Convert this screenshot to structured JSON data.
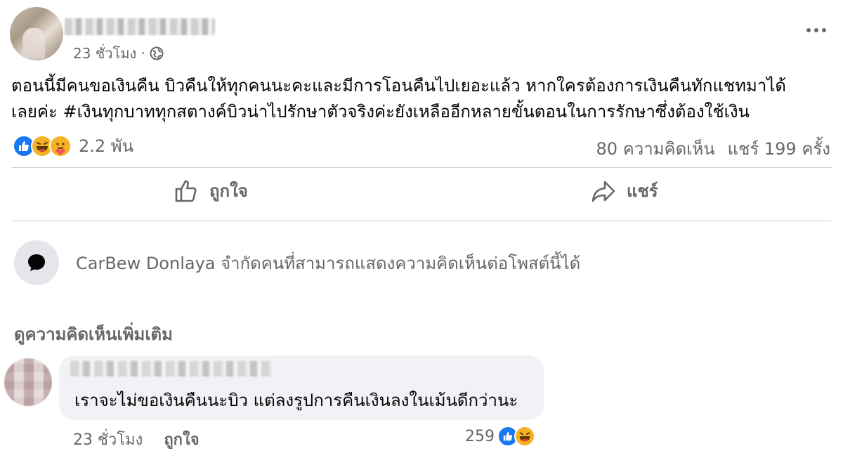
{
  "post": {
    "time": "23 ชั่วโมง",
    "separator": "·",
    "text_line1": "ตอนนี้มีคนขอเงินคืน บิวคืนให้ทุกคนนะคะและมีการโอนคืนไปเยอะแล้ว หากใครต้องการเงินคืนทักแชทมาได้",
    "text_line2": "เลยค่ะ #เงินทุกบาททุกสตางค์บิวน่าไปรักษาตัวจริงค่ะยังเหลืออีกหลายขั้นตอนในการรักษาซึ่งต้องใช้เงิน",
    "reactions": [
      "like",
      "haha",
      "care"
    ],
    "reaction_count": "2.2 พัน",
    "comments_count": "80 ความคิดเห็น",
    "shares_count": "แชร์ 199 ครั้ง"
  },
  "actions": {
    "like_label": "ถูกใจ",
    "share_label": "แชร์"
  },
  "restriction": {
    "text": "CarBew Donlaya จำกัดคนที่สามารถแสดงความคิดเห็นต่อโพสต์นี้ได้"
  },
  "comments": {
    "view_more": "ดูความคิดเห็นเพิ่มเติม",
    "items": [
      {
        "text": "เราจะไม่ขอเงินคืนนะบิว แต่ลงรูปการคืนเงินลงในเม้นดีกว่านะ",
        "time": "23 ชั่วโมง",
        "like_label": "ถูกใจ",
        "reaction_count": "259",
        "reactions": [
          "like",
          "haha"
        ]
      }
    ]
  },
  "colors": {
    "text": "#050505",
    "secondary": "#65676b",
    "like_blue": "#1877f2",
    "emoji_yellow": "#f7b125",
    "bubble": "#f0f2f5",
    "divider": "#ced0d4"
  }
}
